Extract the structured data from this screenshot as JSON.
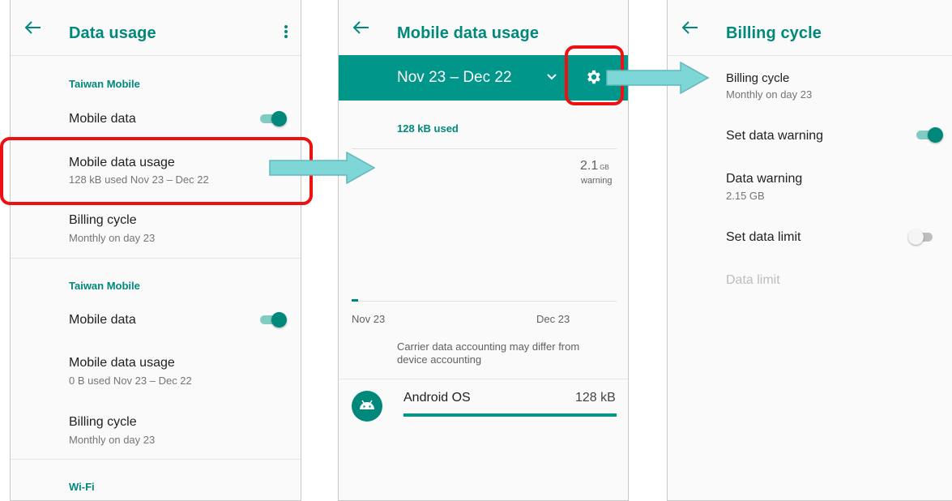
{
  "colors": {
    "accent": "#00897b",
    "highlight": "#ee1111",
    "arrow": "#7fd6d6",
    "bar": "#00968a"
  },
  "screen1": {
    "title": "Data usage",
    "back_icon": "arrow-left-icon",
    "overflow_icon": "more-vert-icon",
    "sections": [
      {
        "header": "Taiwan Mobile",
        "items": [
          {
            "title": "Mobile data",
            "toggle": true
          },
          {
            "title": "Mobile data usage",
            "subtitle": "128 kB used Nov 23 – Dec 22"
          },
          {
            "title": "Billing cycle",
            "subtitle": "Monthly on day 23"
          }
        ]
      },
      {
        "header": "Taiwan Mobile",
        "items": [
          {
            "title": "Mobile data",
            "toggle": true
          },
          {
            "title": "Mobile data usage",
            "subtitle": "0 B used Nov 23 – Dec 22"
          },
          {
            "title": "Billing cycle",
            "subtitle": "Monthly on day 23"
          }
        ]
      },
      {
        "header": "Wi-Fi"
      }
    ]
  },
  "screen2": {
    "title": "Mobile data usage",
    "back_icon": "arrow-left-icon",
    "cycle_range": "Nov 23 – Dec 22",
    "chevron_icon": "chevron-down-icon",
    "settings_icon": "gear-icon",
    "used": "128 kB used",
    "warning_value": "2.1",
    "warning_unit": "GB",
    "warning_label": "warning",
    "axis_start": "Nov 23",
    "axis_end": "Dec 23",
    "note": "Carrier data accounting may differ from device accounting",
    "app": {
      "name": "Android OS",
      "usage": "128 kB",
      "icon": "android-icon",
      "progress": 1.0
    }
  },
  "screen3": {
    "title": "Billing cycle",
    "back_icon": "arrow-left-icon",
    "items": [
      {
        "title": "Billing cycle",
        "subtitle": "Monthly on day 23"
      },
      {
        "title": "Set data warning",
        "toggle": true
      },
      {
        "title": "Data warning",
        "subtitle": "2.15 GB"
      },
      {
        "title": "Set data limit",
        "toggle": false
      },
      {
        "title": "Data limit",
        "disabled": true
      }
    ]
  }
}
